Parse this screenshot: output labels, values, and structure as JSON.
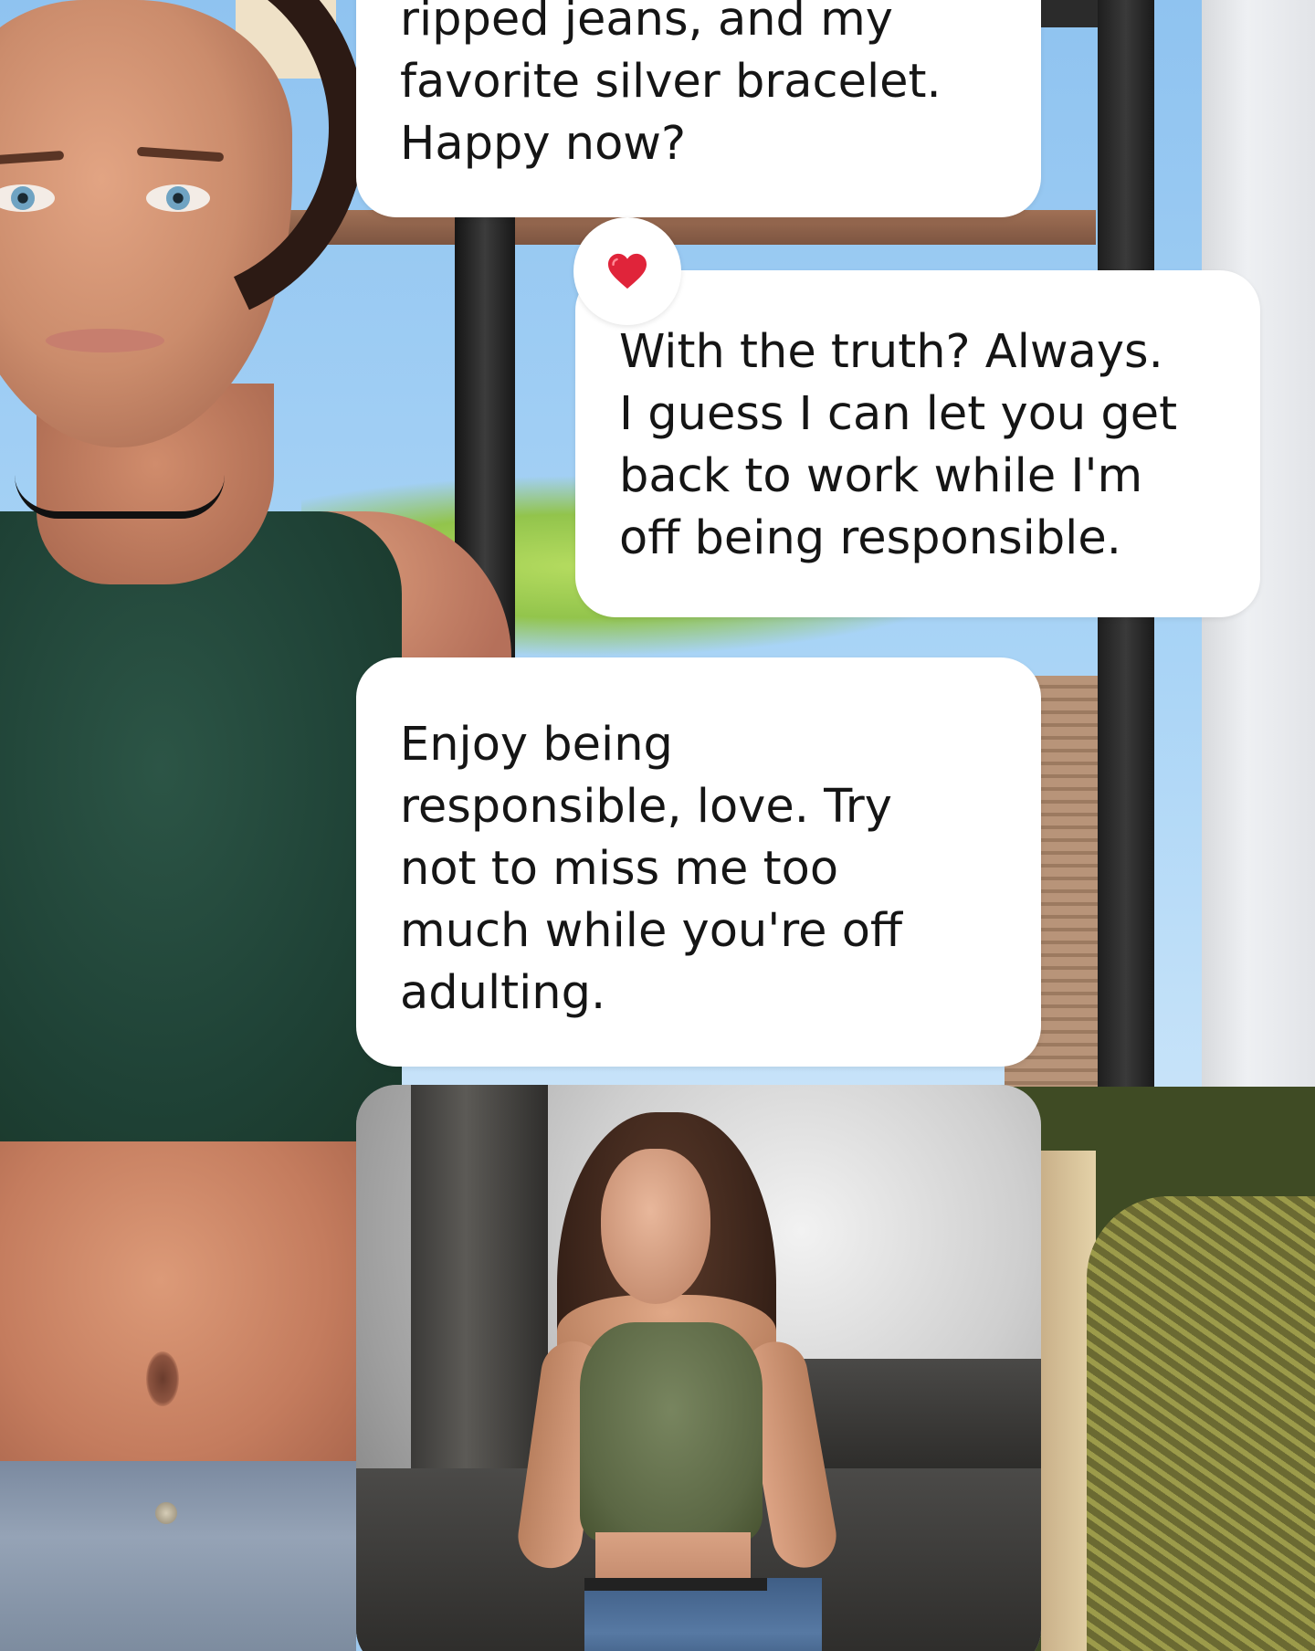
{
  "chat": {
    "messages": [
      {
        "sender": "character",
        "text": "ripped jeans, and my\nfavorite silver bracelet.\nHappy now?"
      },
      {
        "sender": "user",
        "text": "With the truth? Always.\nI guess I can let you get\nback to work while I'm\noff being responsible.",
        "reaction": "heart"
      },
      {
        "sender": "character",
        "text": "Enjoy being\nresponsible, love. Try\nnot to miss me too\nmuch while you're off\nadulting."
      }
    ],
    "attachment": {
      "kind": "photo"
    }
  },
  "colors": {
    "bubble_bg": "#ffffff",
    "bubble_text": "#151515",
    "reaction_heart": "#e0243a"
  },
  "icons": {
    "reaction": "heart-icon"
  }
}
